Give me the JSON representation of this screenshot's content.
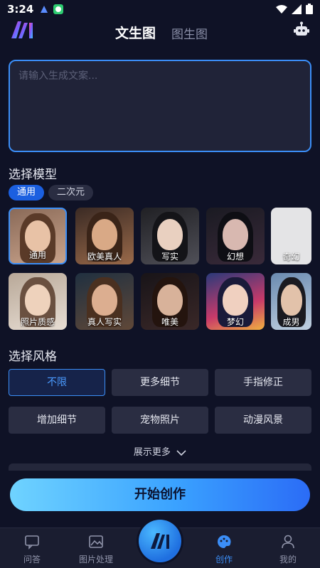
{
  "status": {
    "time": "3:24"
  },
  "header": {
    "tabs": [
      {
        "label": "文生图"
      },
      {
        "label": "图生图"
      }
    ]
  },
  "prompt": {
    "placeholder": "请输入生成文案..."
  },
  "model_section": {
    "title": "选择模型",
    "categories": [
      {
        "label": "通用"
      },
      {
        "label": "二次元"
      }
    ],
    "models": [
      {
        "label": "通用"
      },
      {
        "label": "欧美真人"
      },
      {
        "label": "写实"
      },
      {
        "label": "幻想"
      },
      {
        "label": "奇幻"
      },
      {
        "label": "照片质感"
      },
      {
        "label": "真人写实"
      },
      {
        "label": "唯美"
      },
      {
        "label": "梦幻"
      },
      {
        "label": "成男"
      }
    ]
  },
  "style_section": {
    "title": "选择风格",
    "styles": [
      {
        "label": "不限"
      },
      {
        "label": "更多细节"
      },
      {
        "label": "手指修正"
      },
      {
        "label": "增加细节"
      },
      {
        "label": "宠物照片"
      },
      {
        "label": "动漫风景"
      }
    ],
    "show_more": "展示更多"
  },
  "start_button": {
    "label": "开始创作"
  },
  "bottom_nav": {
    "items": [
      {
        "label": "问答"
      },
      {
        "label": "图片处理"
      },
      {
        "label": "创作"
      },
      {
        "label": "我的"
      }
    ]
  },
  "colors": {
    "accent": "#3b8ef7",
    "background": "#0f1226",
    "card": "#2a2d42"
  },
  "icons": [
    "app-logo-icon",
    "robot-icon",
    "chevron-down-icon",
    "chat-icon",
    "image-icon",
    "palette-icon",
    "user-icon"
  ]
}
